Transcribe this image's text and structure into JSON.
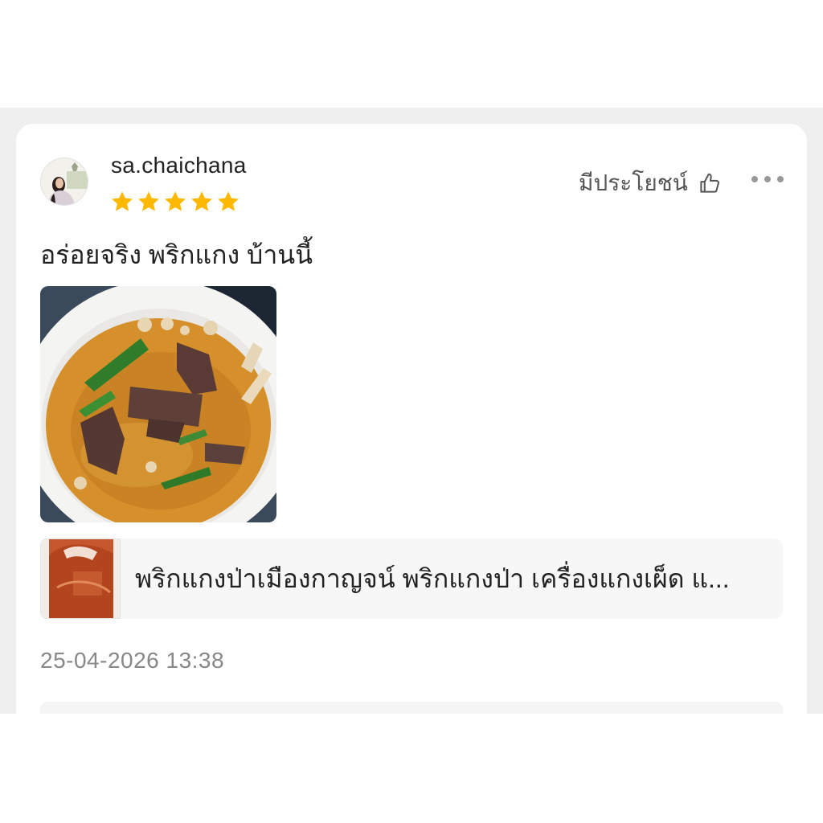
{
  "review": {
    "username": "sa.chaichana",
    "rating": 5,
    "max_rating": 5,
    "star_color": "#FFB800",
    "helpful_label": "มีประโยชน์",
    "text": "อร่อยจริง พริกแกง บ้านนี้",
    "timestamp": "25-04-2026 13:38"
  },
  "icons": {
    "helpful": "thumbs-up-icon",
    "more": "more-options-icon",
    "star": "star-icon"
  },
  "product": {
    "title": "พริกแกงป่าเมืองกาญจน์ พริกแกงป่า  เครื่องแกงเผ็ด แ..."
  }
}
